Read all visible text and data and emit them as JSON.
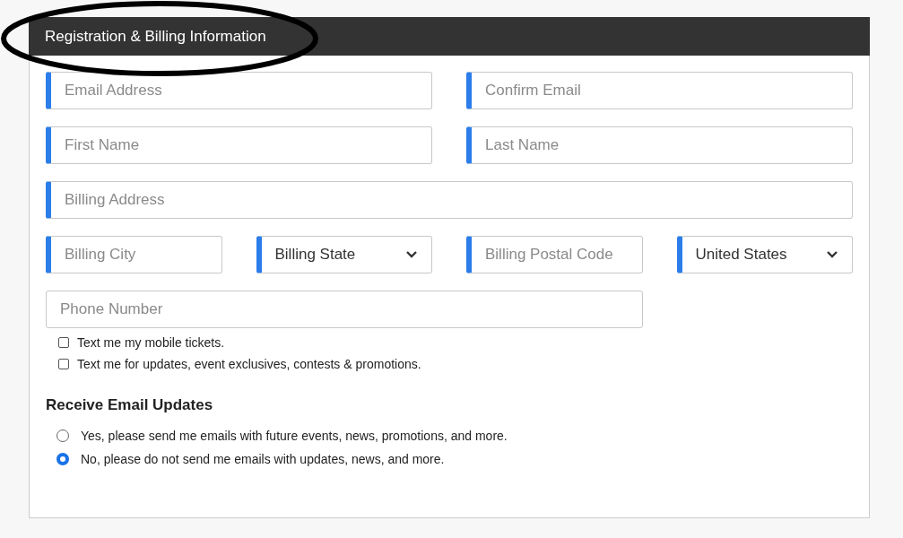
{
  "header": {
    "title": "Registration & Billing Information"
  },
  "rows": [
    [
      {
        "kind": "input",
        "placeholder": "Email Address",
        "required": true
      },
      {
        "kind": "input",
        "placeholder": "Confirm Email",
        "required": true
      }
    ],
    [
      {
        "kind": "input",
        "placeholder": "First Name",
        "required": true
      },
      {
        "kind": "input",
        "placeholder": "Last Name",
        "required": true
      }
    ],
    [
      {
        "kind": "input",
        "placeholder": "Billing Address",
        "required": true
      }
    ],
    [
      {
        "kind": "input",
        "placeholder": "Billing City",
        "required": true
      },
      {
        "kind": "select",
        "value": "Billing State",
        "required": true
      },
      {
        "kind": "input",
        "placeholder": "Billing Postal Code",
        "required": true
      },
      {
        "kind": "select",
        "value": "United States",
        "required": true
      }
    ]
  ],
  "phone": {
    "kind": "input",
    "placeholder": "Phone Number",
    "required": false
  },
  "checkboxes": [
    {
      "label": "Text me my mobile tickets.",
      "checked": false
    },
    {
      "label": "Text me for updates, event exclusives, contests & promotions.",
      "checked": false
    }
  ],
  "email_updates": {
    "heading": "Receive Email Updates",
    "options": [
      {
        "label": "Yes, please send me emails with future events, news, promotions, and more.",
        "selected": false
      },
      {
        "label": "No, please do not send me emails with updates, news, and more.",
        "selected": true
      }
    ]
  }
}
